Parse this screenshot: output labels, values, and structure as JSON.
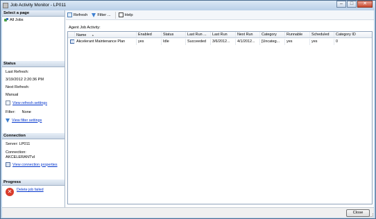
{
  "window": {
    "title": "Job Activity Monitor - LP011",
    "minimize": "–",
    "maximize": "□",
    "close": "✕"
  },
  "left": {
    "select_page": {
      "header": "Select a page",
      "items": [
        {
          "label": "All Jobs",
          "icon": "jobs-icon"
        }
      ]
    },
    "status": {
      "header": "Status",
      "last_refresh_label": "Last Refresh:",
      "last_refresh_value": "3/19/2012 2:20:36 PM",
      "next_refresh_label": "Next Refresh:",
      "next_refresh_value": "Manual",
      "view_refresh_settings": "View refresh settings",
      "filter_label": "Filter:",
      "filter_value": "None",
      "view_filter_settings": "View filter settings"
    },
    "connection": {
      "header": "Connection",
      "server": "Server: LP011",
      "connection_label": "Connection:",
      "connection_value": "AKCELERANT\\d",
      "view_connection_properties": "View connection properties"
    },
    "progress": {
      "header": "Progress",
      "message": "Delete job failed"
    }
  },
  "toolbar": {
    "refresh": "Refresh",
    "filter": "Filter ...",
    "help": "Help"
  },
  "grid": {
    "label": "Agent Job Activity:",
    "columns": [
      "",
      "Name",
      "Enabled",
      "Status",
      "Last Run ...",
      "Last Run",
      "Next Run",
      "Category",
      "Runnable",
      "Scheduled",
      "Category ID"
    ],
    "sort_indicator": "▲",
    "rows": [
      [
        "",
        "Akcelerant Maintenance Plan",
        "yes",
        "Idle",
        "Succeeded",
        "3/6/2012...",
        "4/1/2012...",
        "[Uncateg...",
        "yes",
        "yes",
        "0"
      ]
    ]
  },
  "footer": {
    "close": "Close"
  },
  "colors": {
    "titlebar": "#bcd3ea",
    "link": "#0033cc",
    "error": "#d93b2b"
  }
}
